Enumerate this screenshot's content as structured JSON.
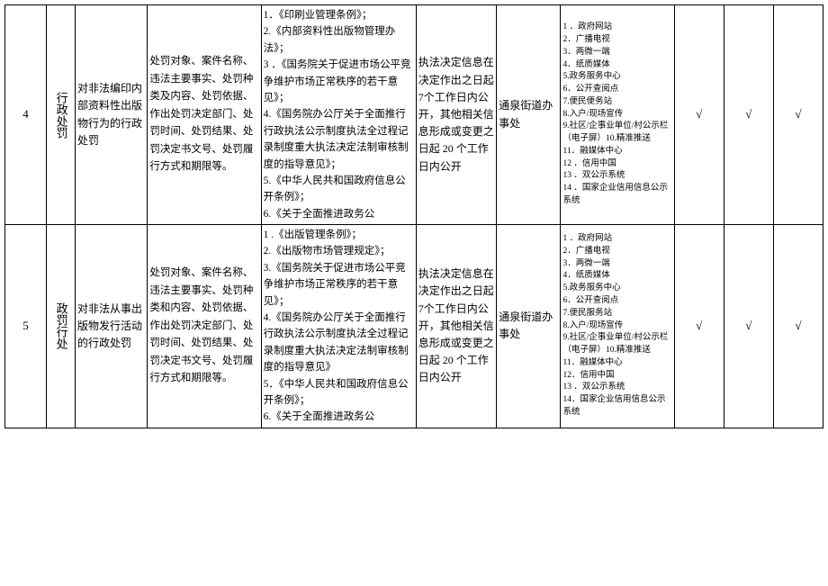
{
  "rows": [
    {
      "num": "4",
      "category": "行政处罚",
      "title": "对非法编印内部资料性出版物行为的行政处罚",
      "content": "处罚对象、案件名称、违法主要事实、处罚种类及内容、处罚依据、作出处罚决定部门、处罚时间、处罚结果、处罚决定书文号、处罚履行方式和期限等。",
      "basis": "1．《印刷业管理条例》；\n2.《内部资料性出版物管理办法》；\n3 ．《国务院关于促进市场公平竞争维护市场正常秩序的若干意见》；\n4.《国务院办公厅关于全面推行行政执法公示制度执法全过程记录制度重大执法决定法制审核制度的指导意见》；\n5.《中华人民共和国政府信息公开条例》；\n6.《关于全面推进政务公",
      "time": "执法决定信息在决定作出之日起 7个工作日内公开，其他相关信息形成或变更之日起 20 个工作日内公开",
      "subject": "通泉街道办事处",
      "channels": "1 ．政府网站\n2．广播电视\n3．两微一端\n4．纸质媒体\n5.政务服务中心\n6．公开查阅点\n7.便民便务站\n8.入户/现场宣传\n9.社区/企事业单位/村公示栏（电子屏）10.精准推送\n11．融媒体中心\n12 ．信用中国\n13 ．双公示系统\n14 ．国家企业信用信息公示系统",
      "m1": "√",
      "m2": "√",
      "m3": "√"
    },
    {
      "num": "5",
      "category": "政罚行处",
      "title": "对非法从事出版物发行活动的行政处罚",
      "content": "处罚对象、案件名称、违法主要事实、处罚种类和内容、处罚依据、作出处罚决定部门、处罚时间、处罚结果、处罚决定书文号、处罚履行方式和期限等。",
      "basis": "1 .《出版管理条例》；\n2.《出版物市场管理规定》；\n3.《国务院关于促进市场公平竞争维护市场正常秩序的若干意见》；\n4.《国务院办公厅关于全面推行行政执法公示制度执法全过程记录制度重大执法决定法制审核制度的指导意见》\n5．《中华人民共和国政府信息公开条例》；\n6.《关于全面推进政务公",
      "time": "执法决定信息在决定作出之日起 7个工作日内公开，其他相关信息形成或变更之日起 20 个工作日内公开",
      "subject": "通泉街道办事处",
      "channels": "1 ．政府网站\n2．广播电视\n3．两微一端\n4．纸质媒体\n5.政务服务中心\n6．公开查阅点\n7.便民服务站\n8.入户/现场宣传\n9.社区/企事业单位/村公示栏（电子屏）10.精准推送\n11．融媒体中心\n12．信用中国\n13 ．双公示系统\n14．国家企业信用信息公示系统",
      "m1": "√",
      "m2": "√",
      "m3": "√"
    }
  ]
}
